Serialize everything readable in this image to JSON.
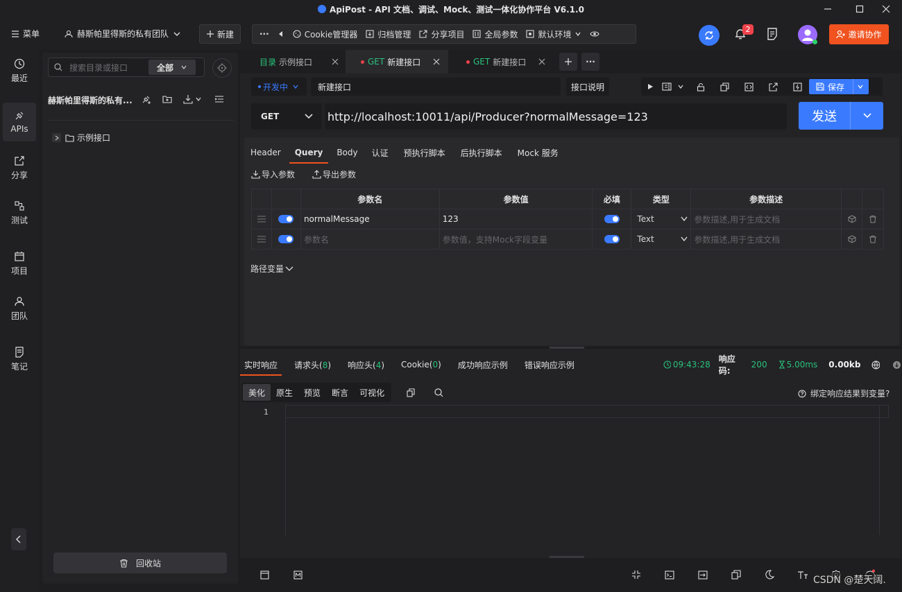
{
  "window": {
    "title": "ApiPost - API 文档、调试、Mock、测试一体化协作平台 V6.1.0"
  },
  "toolbar": {
    "menu_label": "菜单",
    "team_label": "赫斯帕里得斯的私有团队",
    "new_label": "新建",
    "more_label": "···",
    "cookie_label": "Cookie管理器",
    "archive_label": "归档管理",
    "share_label": "分享项目",
    "global_params_label": "全局参数",
    "env_label": "默认环境",
    "notification_count": "2",
    "invite_label": "邀请协作"
  },
  "rail": {
    "items": [
      {
        "label": "最近"
      },
      {
        "label": "APIs"
      },
      {
        "label": "分享"
      },
      {
        "label": "测试"
      },
      {
        "label": "项目"
      },
      {
        "label": "团队"
      },
      {
        "label": "笔记"
      }
    ]
  },
  "dir": {
    "search_placeholder": "搜索目录或接口",
    "filter_value": "全部",
    "project_name": "赫斯帕里得斯的私有...",
    "tree": [
      {
        "label": "示例接口"
      }
    ],
    "recycle_label": "回收站"
  },
  "tabs": [
    {
      "prefix": "目录",
      "label": "示例接口"
    },
    {
      "prefix": "GET",
      "label": "新建接口"
    },
    {
      "prefix": "GET",
      "label": "新建接口"
    }
  ],
  "request": {
    "status": "开发中",
    "name": "新建接口",
    "doc_label": "接口说明",
    "save_label": "保存",
    "method": "GET",
    "url": "http://localhost:10011/api/Producer?normalMessage=123",
    "send_label": "发送"
  },
  "subtabs": [
    "Header",
    "Query",
    "Body",
    "认证",
    "预执行脚本",
    "后执行脚本",
    "Mock 服务"
  ],
  "params": {
    "import_label": "导入参数",
    "export_label": "导出参数",
    "headers": [
      "参数名",
      "参数值",
      "必填",
      "类型",
      "参数描述"
    ],
    "rows": [
      {
        "name": "normalMessage",
        "value": "123",
        "type": "Text",
        "desc": "参数描述,用于生成文档"
      },
      {
        "name": "参数名",
        "value": "参数值，支持Mock字段变量",
        "type": "Text",
        "desc": "参数描述,用于生成文档"
      }
    ],
    "path_vars_label": "路径变量"
  },
  "response": {
    "tabs": [
      {
        "label": "实时响应"
      },
      {
        "label": "请求头(",
        "count": "8",
        "suffix": ")"
      },
      {
        "label": "响应头(",
        "count": "4",
        "suffix": ")"
      },
      {
        "label": "Cookie(",
        "count": "0",
        "suffix": ")"
      },
      {
        "label": "成功响应示例"
      },
      {
        "label": "错误响应示例"
      }
    ],
    "time": "09:43:28",
    "code_label": "响应码:",
    "code": "200",
    "duration": "5.00ms",
    "size": "0.00kb",
    "view_tabs": [
      "美化",
      "原生",
      "预览",
      "断言",
      "可视化"
    ],
    "bind_label": "绑定响应结果到变量?",
    "line_number": "1"
  },
  "watermark": "CSDN @楚天阔.",
  "colors": {
    "accent": "#3a7afe",
    "green": "#28c27a",
    "invite": "#f0531f",
    "badge": "#f0424a"
  }
}
